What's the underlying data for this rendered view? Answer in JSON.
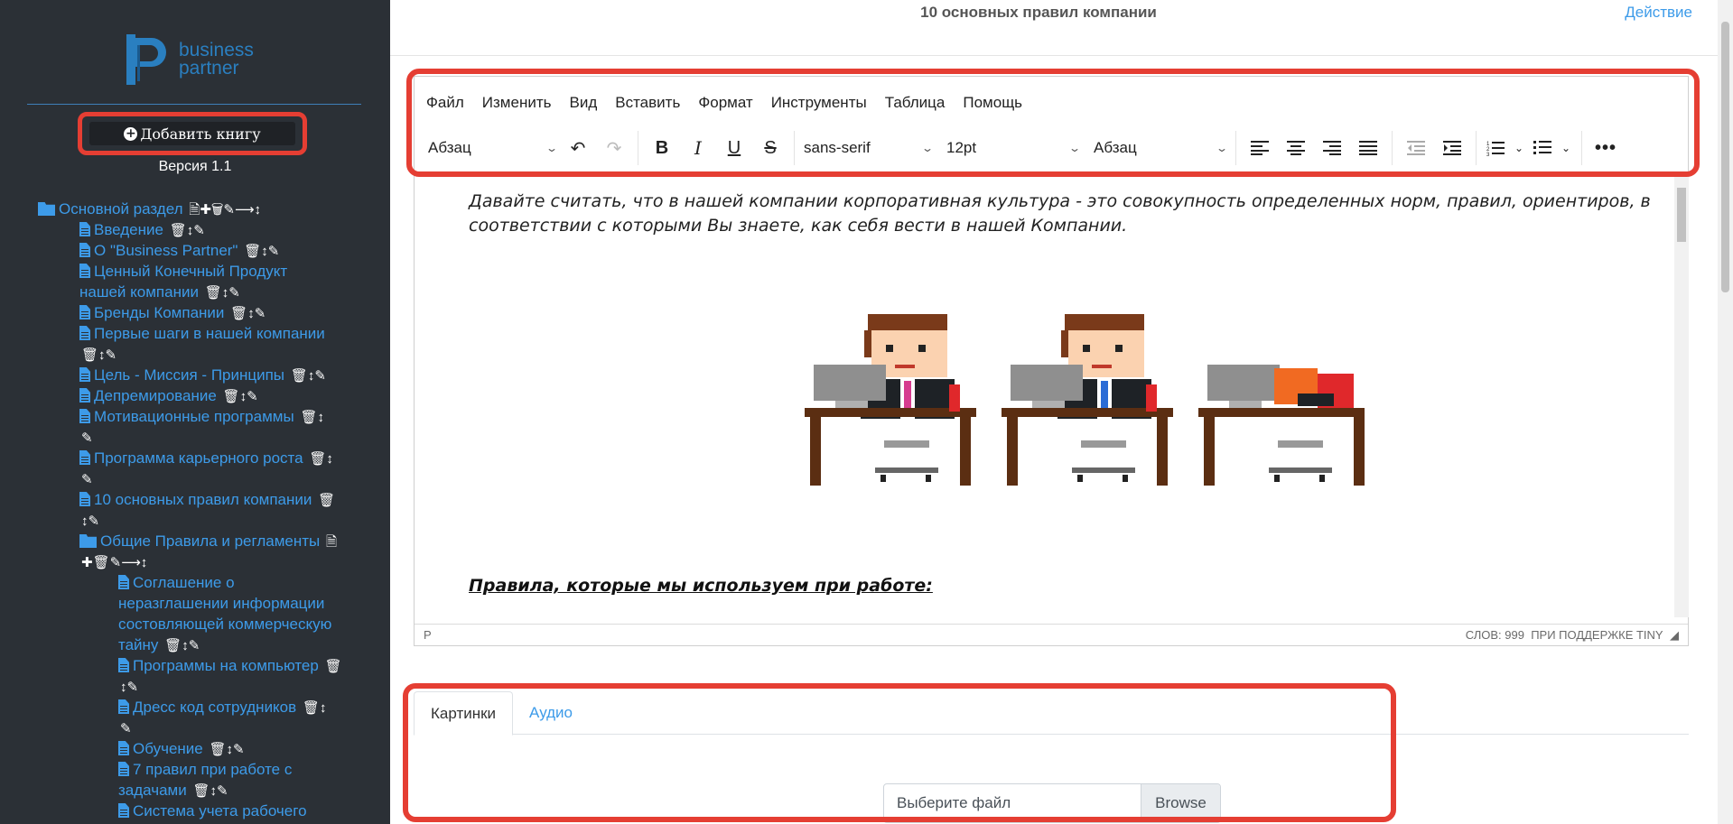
{
  "sidebar": {
    "logo_line1": "business",
    "logo_line2": "partner",
    "add_book_label": "Добавить книгу",
    "version": "Версия 1.1",
    "tree": {
      "root_label": "Основной раздел",
      "items": [
        {
          "label": "Введение"
        },
        {
          "label": "О \"Business Partner\""
        },
        {
          "label_line1": "Ценный Конечный Продукт",
          "label_line2": "нашей компании"
        },
        {
          "label": "Бренды Компании"
        },
        {
          "label": "Первые шаги в нашей компании"
        },
        {
          "label": "Цель - Миссия - Принципы"
        },
        {
          "label": "Депремирование"
        },
        {
          "label": "Мотивационные программы"
        },
        {
          "label": "Программа карьерного роста"
        },
        {
          "label": "10 основных правил компании"
        }
      ],
      "subfolder_label": "Общие Правила и регламенты",
      "subitems": [
        {
          "line1": "Соглашение о",
          "line2": "неразглашении информации",
          "line3": "состовляющей коммерческую",
          "line4": "тайну"
        },
        {
          "label": "Программы на компьютер"
        },
        {
          "label": "Дресс код сотрудников"
        },
        {
          "label": "Обучение"
        },
        {
          "line1": "7 правил при работе с",
          "line2": "задачами"
        },
        {
          "label": "Система учета рабочего"
        }
      ]
    }
  },
  "header": {
    "title": "10 основных правил компании",
    "action_label": "Действие"
  },
  "editor": {
    "menu": [
      "Файл",
      "Изменить",
      "Вид",
      "Вставить",
      "Формат",
      "Инструменты",
      "Таблица",
      "Помощь"
    ],
    "block_format": "Абзац",
    "font_family": "sans-serif",
    "font_size": "12pt",
    "paragraph_format": "Абзац",
    "content_paragraph": "Давайте считать, что в нашей компании корпоративная культура - это совокупность определенных норм, правил, ориентиров, в соответствии с которыми Вы знаете, как себя вести в нашей Компании.",
    "rules_heading": "Правила, которые мы используем при работе:",
    "status_path": "P",
    "status_words": "СЛОВ: 999",
    "status_powered": "ПРИ ПОДДЕРЖКЕ TINY"
  },
  "attachments": {
    "tabs": [
      "Картинки",
      "Аудио"
    ],
    "file_placeholder": "Выберите файл",
    "browse_label": "Browse"
  },
  "colors": {
    "sidebar_bg": "#2b3036",
    "link": "#3d9be9",
    "highlight": "#e53e33"
  }
}
